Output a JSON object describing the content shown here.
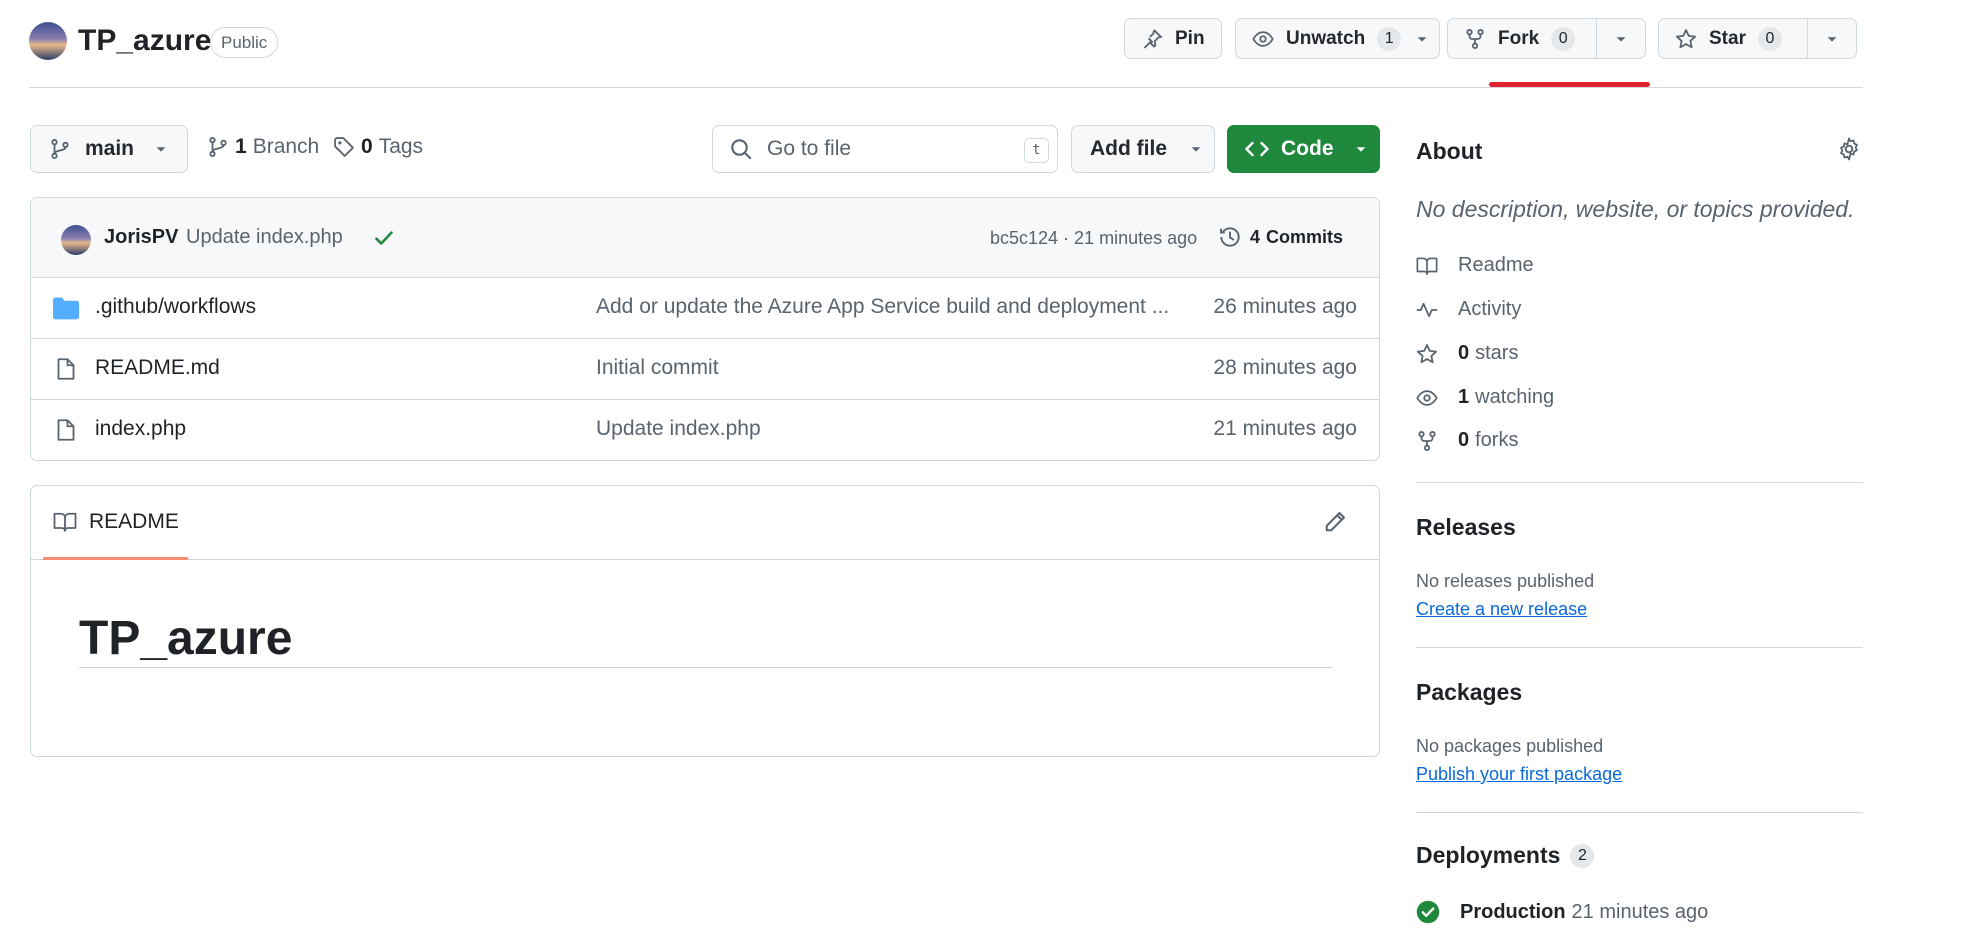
{
  "header": {
    "repo_name": "TP_azure",
    "visibility": "Public",
    "pin_label": "Pin",
    "unwatch_label": "Unwatch",
    "watch_count": "1",
    "fork_label": "Fork",
    "fork_count": "0",
    "star_label": "Star",
    "star_count": "0"
  },
  "toolbar": {
    "branch": "main",
    "branch_count": "1",
    "branch_label": "Branch",
    "tag_count": "0",
    "tag_label": "Tags",
    "search_placeholder": "Go to file",
    "search_shortcut": "t",
    "add_file_label": "Add file",
    "code_label": "Code"
  },
  "latest_commit": {
    "author": "JorisPV",
    "message": "Update index.php",
    "sha_time": "bc5c124 · 21 minutes ago",
    "commits_count": "4",
    "commits_label": "Commits"
  },
  "files": [
    {
      "name": ".github/workflows",
      "type": "folder",
      "message": "Add or update the Azure App Service build and deployment ...",
      "time": "26 minutes ago"
    },
    {
      "name": "README.md",
      "type": "file",
      "message": "Initial commit",
      "time": "28 minutes ago"
    },
    {
      "name": "index.php",
      "type": "file",
      "message": "Update index.php",
      "time": "21 minutes ago"
    }
  ],
  "readme": {
    "tab_label": "README",
    "heading": "TP_azure"
  },
  "about": {
    "title": "About",
    "description": "No description, website, or topics provided.",
    "readme_label": "Readme",
    "activity_label": "Activity",
    "stars_count": "0",
    "stars_label": "stars",
    "watching_count": "1",
    "watching_label": "watching",
    "forks_count": "0",
    "forks_label": "forks"
  },
  "releases": {
    "title": "Releases",
    "empty": "No releases published",
    "link": "Create a new release"
  },
  "packages": {
    "title": "Packages",
    "empty": "No packages published",
    "link": "Publish your first package"
  },
  "deployments": {
    "title": "Deployments",
    "count": "2",
    "items": [
      {
        "name": "Production",
        "time": "21 minutes ago",
        "status_color": "#1f883d"
      }
    ]
  },
  "colors": {
    "primary_green": "#1f883d",
    "link_blue": "#0969da",
    "folder_blue": "#54aeff",
    "fork_underline": "#e3202e",
    "readme_tab_accent": "#fd8c73"
  }
}
